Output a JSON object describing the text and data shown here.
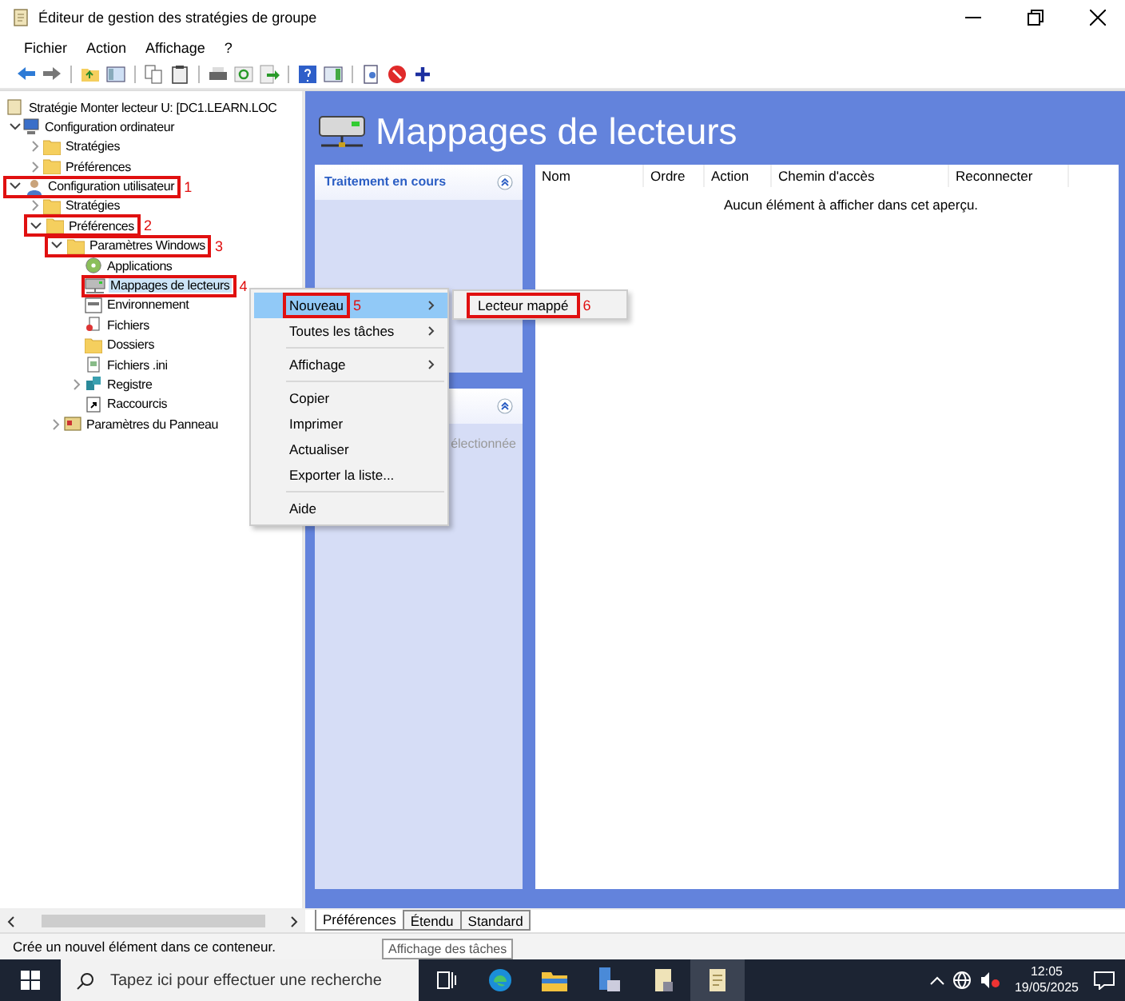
{
  "window": {
    "title": "Éditeur de gestion des stratégies de groupe"
  },
  "menu_bar": [
    "Fichier",
    "Action",
    "Affichage",
    "?"
  ],
  "tree": {
    "root": "Stratégie Monter lecteur U: [DC1.LEARN.LOC",
    "items": [
      {
        "label": "Configuration ordinateur",
        "kind": "computer",
        "expanded": true,
        "selected": false,
        "children": [
          {
            "label": "Stratégies",
            "kind": "folder",
            "expanded": false,
            "selected": false
          },
          {
            "label": "Préférences",
            "kind": "folder",
            "expanded": false,
            "selected": false
          }
        ]
      },
      {
        "label": "Configuration utilisateur",
        "kind": "user",
        "expanded": true,
        "selected": false,
        "annotation": "1",
        "children": [
          {
            "label": "Stratégies",
            "kind": "folder",
            "expanded": false,
            "selected": false
          },
          {
            "label": "Préférences",
            "kind": "folder",
            "expanded": true,
            "selected": false,
            "annotation": "2",
            "children": [
              {
                "label": "Paramètres Windows",
                "kind": "folder",
                "expanded": true,
                "selected": false,
                "annotation": "3",
                "children": [
                  {
                    "label": "Applications",
                    "kind": "app",
                    "selected": false
                  },
                  {
                    "label": "Mappages de lecteurs",
                    "kind": "drive",
                    "selected": true,
                    "annotation": "4"
                  },
                  {
                    "label": "Environnement",
                    "kind": "env",
                    "selected": false
                  },
                  {
                    "label": "Fichiers",
                    "kind": "files",
                    "selected": false
                  },
                  {
                    "label": "Dossiers",
                    "kind": "folder",
                    "selected": false
                  },
                  {
                    "label": "Fichiers .ini",
                    "kind": "ini",
                    "selected": false
                  },
                  {
                    "label": "Registre",
                    "kind": "registry",
                    "expanded": false,
                    "selected": false
                  },
                  {
                    "label": "Raccourcis",
                    "kind": "shortcut",
                    "selected": false
                  }
                ]
              },
              {
                "label": "Paramètres du Panneau",
                "kind": "panel",
                "expanded": false,
                "selected": false
              }
            ]
          }
        ]
      }
    ]
  },
  "content": {
    "title": "Mappages de lecteurs",
    "task_cards": [
      {
        "title": "Traitement en cours"
      },
      {
        "text": "électionnée"
      }
    ],
    "columns": [
      "Nom",
      "Ordre",
      "Action",
      "Chemin d'accès",
      "Reconnecter"
    ],
    "empty_message": "Aucun élément à afficher dans cet aperçu."
  },
  "context_menu": {
    "items": [
      {
        "kind": "item",
        "label": "Nouveau",
        "selected": true,
        "submenu": true,
        "annotation": "5"
      },
      {
        "kind": "item",
        "label": "Toutes les tâches",
        "selected": false,
        "submenu": true
      },
      {
        "kind": "separator"
      },
      {
        "kind": "item",
        "label": "Affichage",
        "selected": false,
        "submenu": true
      },
      {
        "kind": "separator"
      },
      {
        "kind": "item",
        "label": "Copier",
        "selected": false,
        "submenu": false
      },
      {
        "kind": "item",
        "label": "Imprimer",
        "selected": false,
        "submenu": false
      },
      {
        "kind": "item",
        "label": "Actualiser",
        "selected": false,
        "submenu": false
      },
      {
        "kind": "item",
        "label": "Exporter la liste...",
        "selected": false,
        "submenu": false
      },
      {
        "kind": "separator"
      },
      {
        "kind": "item",
        "label": "Aide",
        "selected": false,
        "submenu": false
      }
    ],
    "submenu": {
      "label": "Lecteur mappé",
      "annotation": "6"
    }
  },
  "view_tabs": [
    {
      "label": "Préférences",
      "selected": true
    },
    {
      "label": "Étendu",
      "selected": false
    },
    {
      "label": "Standard",
      "selected": false
    }
  ],
  "status_bar": {
    "text": "Crée un nouvel élément dans ce conteneur.",
    "tooltip": "Affichage des tâches"
  },
  "taskbar": {
    "search": {
      "placeholder": "Tapez ici pour effectuer une recherche"
    },
    "time": "12:05",
    "date": "19/05/2025"
  }
}
